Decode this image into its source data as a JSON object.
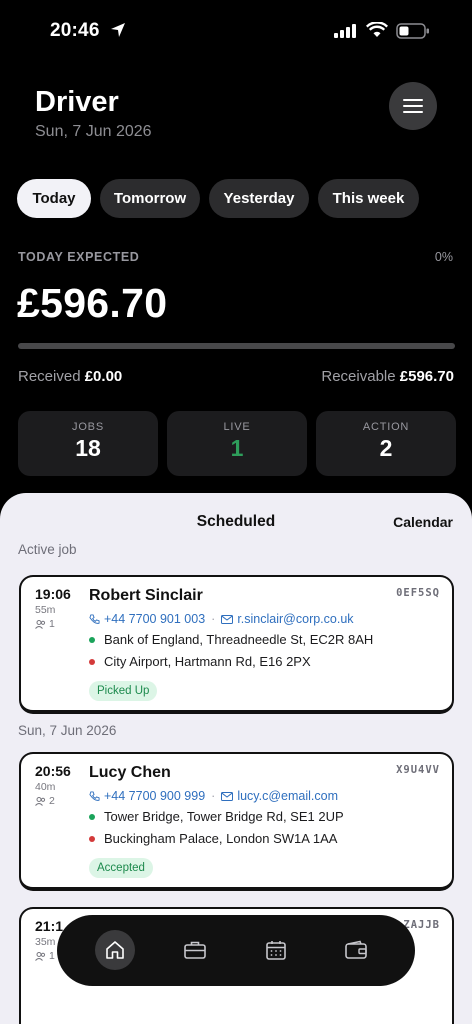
{
  "status_bar": {
    "time": "20:46"
  },
  "header": {
    "title": "Driver",
    "date": "Sun, 7 Jun 2026"
  },
  "tabs": [
    {
      "label": "Today",
      "active": true
    },
    {
      "label": "Tomorrow",
      "active": false
    },
    {
      "label": "Yesterday",
      "active": false
    },
    {
      "label": "This week",
      "active": false
    }
  ],
  "earnings": {
    "expected_label": "TODAY EXPECTED",
    "percent": "0%",
    "progress_fraction": 0,
    "amount": "£596.70",
    "received_label": "Received",
    "received_value": "£0.00",
    "receivable_label": "Receivable",
    "receivable_value": "£596.70"
  },
  "stats": [
    {
      "label": "JOBS",
      "value": "18"
    },
    {
      "label": "LIVE",
      "value": "1"
    },
    {
      "label": "ACTION",
      "value": "2"
    }
  ],
  "sheet": {
    "title": "Scheduled",
    "calendar_label": "Calendar",
    "active_label": "Active job",
    "day_label": "Sun, 7 Jun 2026"
  },
  "jobs": [
    {
      "time": "19:06",
      "duration": "55m",
      "pax": "1",
      "name": "Robert Sinclair",
      "ref": "0EF5SQ",
      "phone": "+44 7700 901 003",
      "email": "r.sinclair@corp.co.uk",
      "pickup": "Bank of England, Threadneedle St, EC2R 8AH",
      "dropoff": "City Airport, Hartmann Rd, E16 2PX",
      "status": "Picked Up"
    },
    {
      "time": "20:56",
      "duration": "40m",
      "pax": "2",
      "name": "Lucy Chen",
      "ref": "X9U4VV",
      "phone": "+44 7700 900 999",
      "email": "lucy.c@email.com",
      "pickup": "Tower Bridge, Tower Bridge Rd, SE1 2UP",
      "dropoff": "Buckingham Palace, London SW1A 1AA",
      "status": "Accepted"
    },
    {
      "time": "21:1",
      "duration": "35m",
      "pax": "1",
      "ref": "ZAJJB"
    }
  ],
  "nav": {
    "icons": [
      "home-icon",
      "briefcase-icon",
      "calendar-icon",
      "wallet-icon"
    ],
    "active": "home-icon"
  },
  "colors": {
    "live": "#2e9e5b",
    "link": "#2f6fbe",
    "chip_bg": "#dcf5e6",
    "chip_text": "#1d8a4d"
  }
}
